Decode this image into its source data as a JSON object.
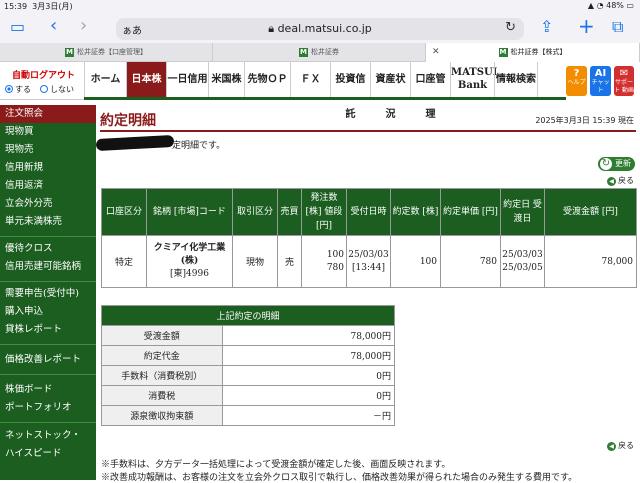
{
  "status": {
    "time": "15:39",
    "date": "3月3日(月)",
    "battery": "48%"
  },
  "browser": {
    "aa": "ぁあ",
    "host": "deal.matsui.co.jp",
    "lock_icon": "lock-icon"
  },
  "tabs": [
    "松井証券【口座管理】",
    "松井証券",
    "松井証券【株式】"
  ],
  "logout": {
    "label": "自動ログアウト",
    "opt_on": "する",
    "opt_off": "しない"
  },
  "nav": [
    "ホーム",
    "日本株",
    "一日信用",
    "米国株",
    "先物ＯＰ",
    "ＦＸ",
    "投資信託",
    "資産状況",
    "口座管理",
    "MATSUI Bank",
    "情報検索"
  ],
  "icons": [
    {
      "glyph": "?",
      "label": "ヘルプ",
      "color": "#f28c00"
    },
    {
      "glyph": "AI",
      "label": "チャット",
      "color": "#1a73e8"
    },
    {
      "glyph": "✉",
      "label": "サポート 動画",
      "color": "#d32f2f"
    },
    {
      "glyph": "⏻",
      "label": "ログ アウト",
      "color": "#2e7d32"
    }
  ],
  "sidebar": [
    "注文照会",
    "現物買",
    "現物売",
    "信用新規",
    "信用返済",
    "立会外分売",
    "単元未満株売",
    "優待クロス",
    "信用売建可能銘柄",
    "需要申告(受付中)",
    "購入申込",
    "貸株レポート",
    "価格改善レポート",
    "株価ボード",
    "ポートフォリオ",
    "ネットストック・",
    "ハイスピード"
  ],
  "page": {
    "title": "約定明細",
    "datetime": "2025年3月3日 15:39 現在",
    "note": "定明細です。",
    "refresh": "更新",
    "back": "戻る"
  },
  "table": {
    "headers": [
      "口座区分",
      "銘柄 [市場]コード",
      "取引区分",
      "売買",
      "発注数 [株] 値段[円]",
      "受付日時",
      "約定数 [株]",
      "約定単価 [円]",
      "約定日 受渡日",
      "受渡金額 [円]"
    ],
    "row": {
      "account": "特定",
      "name": "クミアイ化学工業 (株)",
      "code": "[東]4996",
      "kind": "現物",
      "side": "売",
      "qty": "100",
      "price": "780",
      "recv_date": "25/03/03",
      "recv_time": "[13:44]",
      "exec_qty": "100",
      "exec_price": "780",
      "exec_date": "25/03/03",
      "settle_date": "25/03/05",
      "amount": "78,000"
    }
  },
  "summary": {
    "title": "上記約定の明細",
    "rows": [
      {
        "label": "受渡金額",
        "value": "78,000円"
      },
      {
        "label": "約定代金",
        "value": "78,000円"
      },
      {
        "label": "手数料（消費税別）",
        "value": "0円"
      },
      {
        "label": "消費税",
        "value": "0円"
      },
      {
        "label": "源泉徴収拘束額",
        "value": "－円"
      }
    ]
  },
  "footnotes": [
    "※手数料は、夕方データ一括処理によって受渡金額が確定した後、画面反映されます。",
    "※改善成功報酬は、お客様の注文を立会外クロス取引で執行し、価格改善効果が得られた場合のみ発生する費用です。"
  ]
}
